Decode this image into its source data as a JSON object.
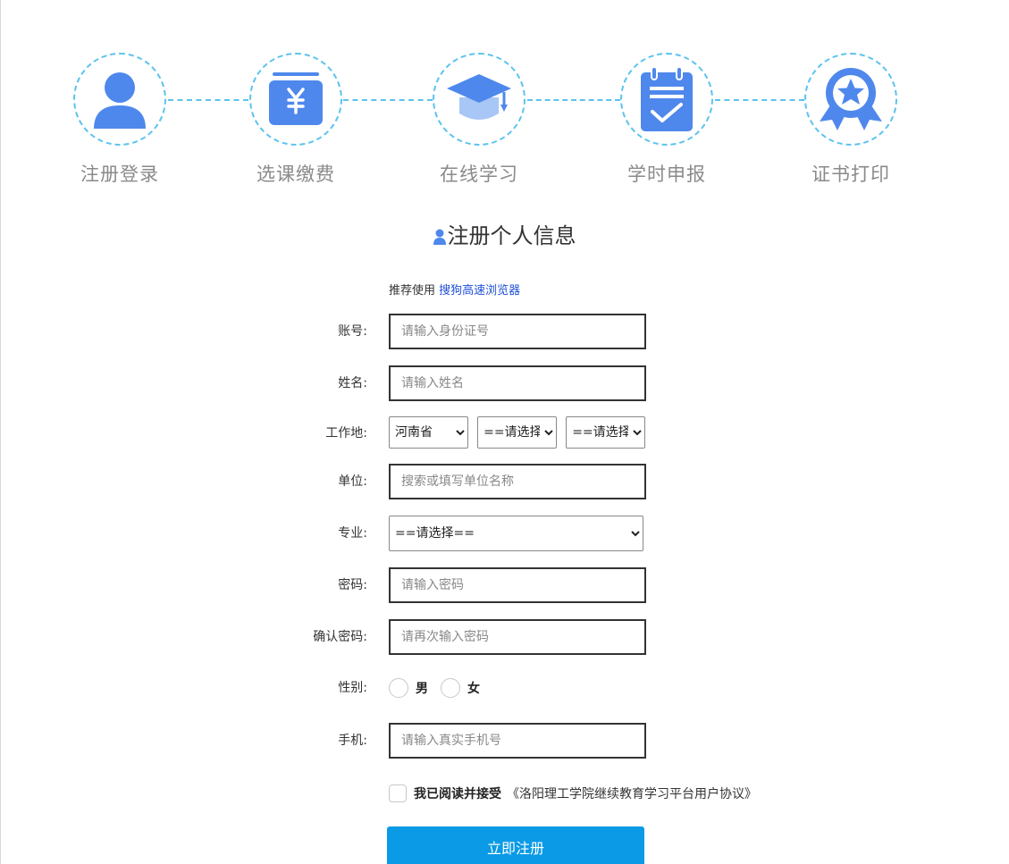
{
  "colors": {
    "accent": "#4f88ec",
    "dash": "#5bc3ee",
    "submit": "#0a9ae6",
    "link": "#1f4fd8"
  },
  "steps": [
    {
      "label": "注册登录",
      "icon": "user-icon"
    },
    {
      "label": "选课缴费",
      "icon": "yuan-wallet-icon"
    },
    {
      "label": "在线学习",
      "icon": "graduation-cap-icon"
    },
    {
      "label": "学时申报",
      "icon": "checklist-icon"
    },
    {
      "label": "证书打印",
      "icon": "award-badge-icon"
    }
  ],
  "form": {
    "title": "注册个人信息",
    "recommend_prefix": "推荐使用",
    "recommend_link": "搜狗高速浏览器",
    "account": {
      "label": "账号:",
      "placeholder": "请输入身份证号",
      "value": ""
    },
    "name": {
      "label": "姓名:",
      "placeholder": "请输入姓名",
      "value": ""
    },
    "workplace": {
      "label": "工作地:",
      "province": "河南省",
      "city": "==请选择==",
      "district": "==请选择=="
    },
    "unit": {
      "label": "单位:",
      "placeholder": "搜索或填写单位名称",
      "value": ""
    },
    "major": {
      "label": "专业:",
      "selected": "==请选择=="
    },
    "password": {
      "label": "密码:",
      "placeholder": "请输入密码",
      "value": ""
    },
    "confirm_password": {
      "label": "确认密码:",
      "placeholder": "请再次输入密码",
      "value": ""
    },
    "gender": {
      "label": "性别:",
      "options": [
        "男",
        "女"
      ]
    },
    "phone": {
      "label": "手机:",
      "placeholder": "请输入真实手机号",
      "value": ""
    },
    "agree_bold": "我已阅读并接受",
    "agree_link": "《洛阳理工学院继续教育学习平台用户协议》",
    "submit_label": "立即注册"
  }
}
